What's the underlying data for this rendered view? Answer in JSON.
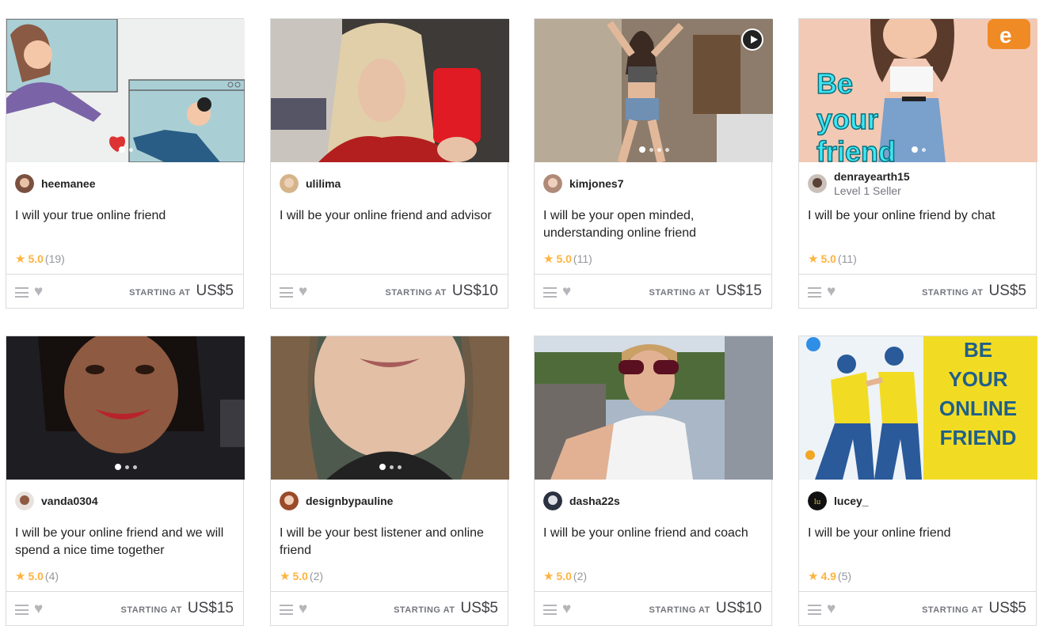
{
  "cards": [
    {
      "seller": "heemanee",
      "level": "",
      "title": "I will your true online friend",
      "rating": "5.0",
      "reviews": "(19)",
      "starting": "STARTING AT",
      "price": "US$5"
    },
    {
      "seller": "ulilima",
      "level": "",
      "title": "I will be your online friend and advisor",
      "rating": "",
      "reviews": "",
      "starting": "STARTING AT",
      "price": "US$10"
    },
    {
      "seller": "kimjones7",
      "level": "",
      "title": "I will be your open minded, understanding online friend",
      "rating": "5.0",
      "reviews": "(11)",
      "starting": "STARTING AT",
      "price": "US$15"
    },
    {
      "seller": "denrayearth15",
      "level": "Level 1 Seller",
      "title": "I will be your online friend by chat",
      "rating": "5.0",
      "reviews": "(11)",
      "starting": "STARTING AT",
      "price": "US$5",
      "thumb_text": [
        "Be",
        "your",
        "friend"
      ]
    },
    {
      "seller": "vanda0304",
      "level": "",
      "title": "I will be your online friend and we will spend a nice time together",
      "rating": "5.0",
      "reviews": "(4)",
      "starting": "STARTING AT",
      "price": "US$15"
    },
    {
      "seller": "designbypauline",
      "level": "",
      "title": "I will be your best listener and online friend",
      "rating": "5.0",
      "reviews": "(2)",
      "starting": "STARTING AT",
      "price": "US$5"
    },
    {
      "seller": "dasha22s",
      "level": "",
      "title": "I will be your online friend and coach",
      "rating": "5.0",
      "reviews": "(2)",
      "starting": "STARTING AT",
      "price": "US$10"
    },
    {
      "seller": "lucey_",
      "level": "",
      "title": "I will be your online friend",
      "rating": "4.9",
      "reviews": "(5)",
      "starting": "STARTING AT",
      "price": "US$5",
      "thumb_text": [
        "BE",
        "YOUR",
        "ONLINE",
        "FRIEND"
      ]
    }
  ],
  "icons": {
    "star": "star-icon",
    "menu": "collections-menu-icon",
    "heart": "heart-icon",
    "play": "play-icon"
  },
  "colors": {
    "rating": "#ffb33e",
    "muted": "#74767e",
    "border": "#dadbdd"
  }
}
